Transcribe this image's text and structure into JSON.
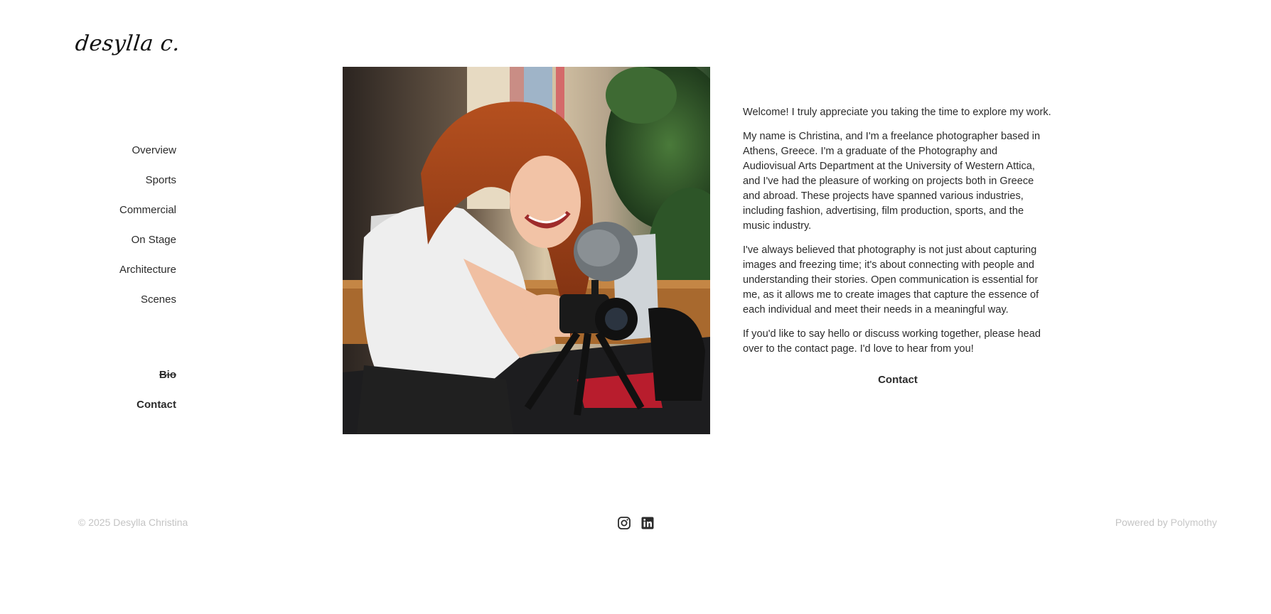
{
  "header": {
    "logo_text": "desylla c."
  },
  "nav": {
    "items": [
      {
        "label": "Overview"
      },
      {
        "label": "Sports"
      },
      {
        "label": "Commercial"
      },
      {
        "label": "On Stage"
      },
      {
        "label": "Architecture"
      },
      {
        "label": "Scenes"
      }
    ],
    "secondary": [
      {
        "label": "Bio",
        "active": true
      },
      {
        "label": "Contact"
      }
    ]
  },
  "main": {
    "photo_icon": "portrait-photo",
    "paragraphs": [
      "Welcome! I truly appreciate you taking the time to explore my work.",
      "My name is Christina, and I'm a freelance photographer based in Athens, Greece. I'm a graduate of the Photography and Audiovisual Arts Department at the University of Western Attica, and I've had the pleasure of working on projects both in Greece and abroad. These projects have spanned various industries, including fashion, advertising, film production, sports, and the music industry.",
      "I've always believed that photography is not just about capturing images and freezing time; it's about connecting with people and understanding their stories. Open communication is essential for me, as it allows me to create images that capture the essence of each individual and meet their needs in a meaningful way.",
      "If you'd like to say hello or discuss working together, please head over to the contact page. I'd love to hear from you!"
    ],
    "contact_label": "Contact"
  },
  "footer": {
    "copyright": "© 2025 Desylla Christina",
    "powered_prefix": "Powered by ",
    "powered_link": "Polymothy",
    "social_icons": [
      "instagram-icon",
      "linkedin-icon"
    ]
  },
  "colors": {
    "text": "#2b2b2b",
    "muted": "#c4c4c4",
    "background": "#ffffff"
  }
}
